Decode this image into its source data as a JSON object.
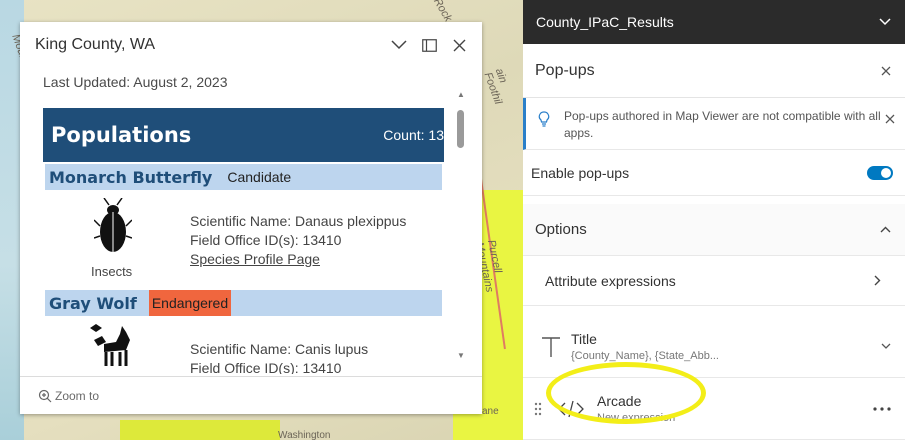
{
  "map": {
    "labels": [
      "Rock",
      "Mountain",
      "ain Foothil",
      "Purcell Mountains",
      "ane",
      "Washington"
    ]
  },
  "popup": {
    "title": "King County, WA",
    "last_updated": "Last Updated: August 2, 2023",
    "banner_title": "Populations",
    "banner_count": "Count: 13",
    "species": [
      {
        "name": "Monarch Butterfly",
        "status": "Candidate",
        "scientific": "Scientific Name: Danaus plexippus",
        "office": "Field Office ID(s): 13410",
        "link": "Species Profile Page",
        "group": "Insects"
      },
      {
        "name": "Gray Wolf",
        "status": "Endangered",
        "scientific": "Scientific Name: Canis lupus",
        "office": "Field Office ID(s): 13410"
      }
    ],
    "zoom_to": "Zoom to"
  },
  "panel": {
    "layer_name": "County_IPaC_Results",
    "section_title": "Pop-ups",
    "notice": "Pop-ups authored in Map Viewer are not compatible with all apps.",
    "enable_label": "Enable pop-ups",
    "options_label": "Options",
    "attribute_expressions": "Attribute expressions",
    "title_card": {
      "title": "Title",
      "subtitle": "{County_Name}, {State_Abb..."
    },
    "arcade_card": {
      "title": "Arcade",
      "subtitle": "New expression"
    }
  },
  "colors": {
    "banner": "#1f4e79",
    "species_bar": "#bdd5ee",
    "endangered": "#f0663e",
    "toggle": "#0079c1",
    "highlight": "#f3ee18"
  }
}
